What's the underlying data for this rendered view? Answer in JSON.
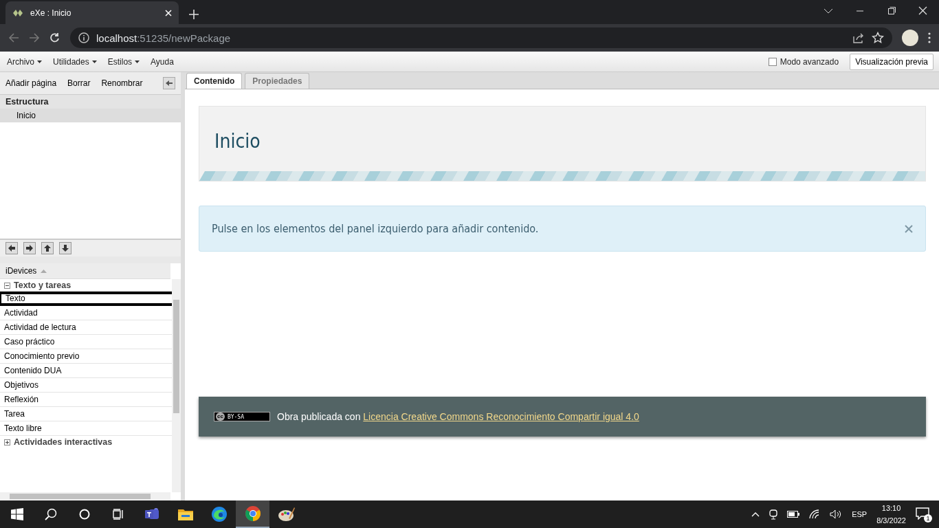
{
  "browser": {
    "tab_title": "eXe : Inicio",
    "url_host": "localhost",
    "url_path": ":51235/newPackage"
  },
  "menu": [
    {
      "label": "Archivo",
      "dropdown": true
    },
    {
      "label": "Utilidades",
      "dropdown": true
    },
    {
      "label": "Estilos",
      "dropdown": true
    },
    {
      "label": "Ayuda",
      "dropdown": false
    }
  ],
  "advanced_mode": {
    "label": "Modo avanzado",
    "checked": false
  },
  "preview_button": "Visualización previa",
  "page_toolbar": [
    "Añadir página",
    "Borrar",
    "Renombrar"
  ],
  "structure": {
    "title": "Estructura",
    "pages": [
      {
        "label": "Inicio",
        "selected": true
      }
    ]
  },
  "idevices": {
    "title": "iDevices",
    "groups": [
      {
        "label": "Texto y tareas",
        "expanded": true,
        "items": [
          {
            "label": "Texto",
            "selected": true
          },
          {
            "label": "Actividad",
            "selected": false
          },
          {
            "label": "Actividad de lectura",
            "selected": false
          },
          {
            "label": "Caso práctico",
            "selected": false
          },
          {
            "label": "Conocimiento previo",
            "selected": false
          },
          {
            "label": "Contenido DUA",
            "selected": false
          },
          {
            "label": "Objetivos",
            "selected": false
          },
          {
            "label": "Reflexión",
            "selected": false
          },
          {
            "label": "Tarea",
            "selected": false
          },
          {
            "label": "Texto libre",
            "selected": false
          }
        ]
      },
      {
        "label": "Actividades interactivas",
        "expanded": false
      }
    ]
  },
  "tabs": [
    {
      "label": "Contenido",
      "selected": true
    },
    {
      "label": "Propiedades",
      "selected": false
    }
  ],
  "page_title": "Inicio",
  "alert": "Pulse en los elementos del panel izquierdo para añadir contenido.",
  "footer": {
    "badge_mark": "cc",
    "badge_label": "BY-SA",
    "text": "Obra publicada con",
    "link": "Licencia Creative Commons Reconocimiento Compartir igual 4.0"
  },
  "taskbar": {
    "apps": [
      {
        "kind": "teams",
        "selected": false
      },
      {
        "kind": "explorer",
        "selected": false
      },
      {
        "kind": "edge",
        "selected": false
      },
      {
        "kind": "chrome",
        "selected": true
      },
      {
        "kind": "paint",
        "selected": false
      }
    ],
    "language": "ESP",
    "time": "13:10",
    "date": "8/3/2022",
    "notifications": "1"
  }
}
